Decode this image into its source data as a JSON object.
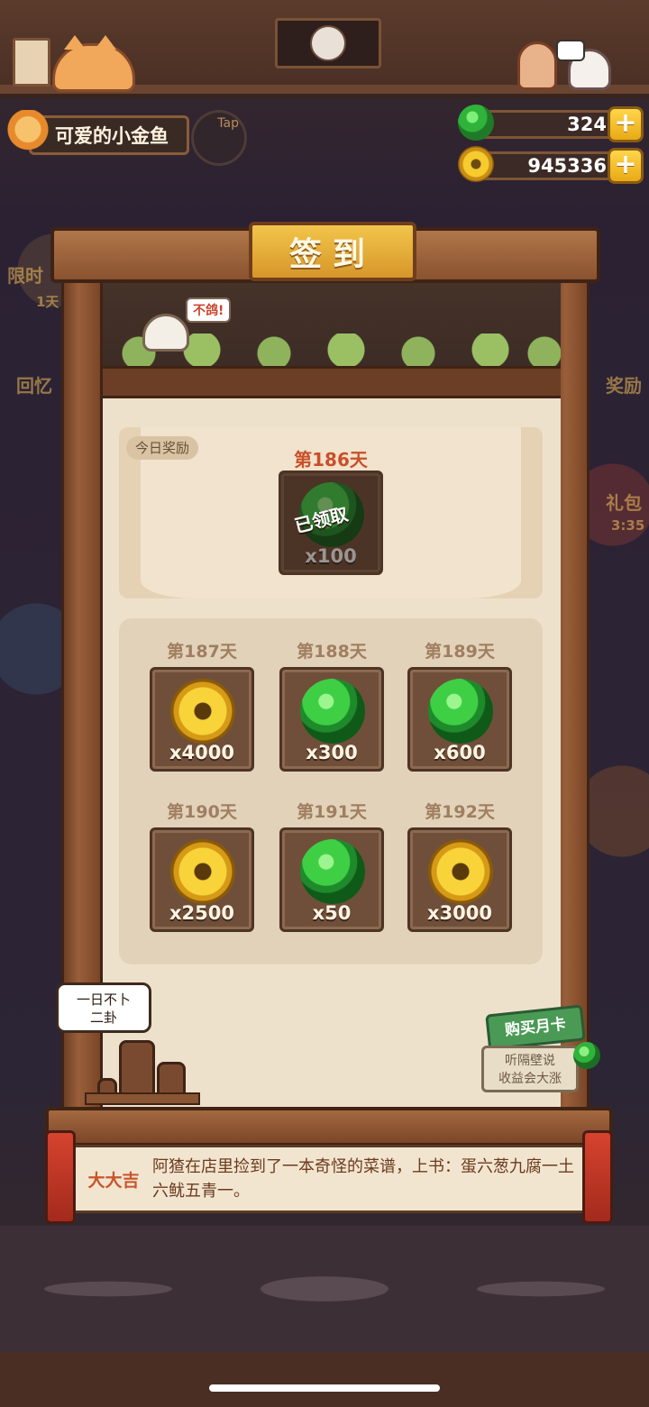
{
  "player": {
    "name": "可爱的小金鱼",
    "tap_hint": "Tap"
  },
  "currency": {
    "jade": {
      "value": "324",
      "icon": "jade-icon",
      "plus": "+"
    },
    "coin": {
      "value": "945336",
      "icon": "coin-icon",
      "plus": "+"
    }
  },
  "background_labels": {
    "left_1": "限时",
    "left_2": "1天",
    "left_3": "回忆",
    "right_1": "奖励",
    "right_2": "礼包",
    "right_3": "3:35"
  },
  "signin": {
    "title": "签到",
    "bird_say": "不鸽!",
    "today_tag": "今日奖励",
    "today": {
      "day": "第186天",
      "reward": "jade",
      "qty": "x100",
      "status": "已领取"
    },
    "upcoming": [
      {
        "day": "第187天",
        "reward": "coin",
        "qty": "x4000"
      },
      {
        "day": "第188天",
        "reward": "jade",
        "qty": "x300"
      },
      {
        "day": "第189天",
        "reward": "jade",
        "qty": "x600"
      },
      {
        "day": "第190天",
        "reward": "coin",
        "qty": "x2500"
      },
      {
        "day": "第191天",
        "reward": "jade",
        "qty": "x50"
      },
      {
        "day": "第192天",
        "reward": "coin",
        "qty": "x3000"
      }
    ]
  },
  "speech": {
    "line1": "一日不卜",
    "line2": "二卦"
  },
  "month_card": {
    "button": "购买月卡",
    "sign_line1": "听隔壁说",
    "sign_line2": "收益会大涨"
  },
  "fortune": {
    "label": "大大吉",
    "text": "阿猹在店里捡到了一本奇怪的菜谱，上书：蛋六葱九腐一土六鱿五青一。"
  }
}
